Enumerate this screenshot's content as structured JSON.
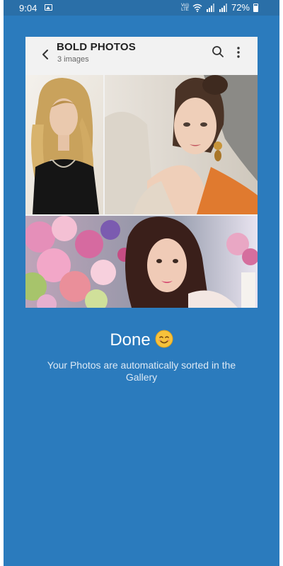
{
  "status_bar": {
    "time": "9:04",
    "volte_line1": "Vo))",
    "volte_line2": "LTE",
    "battery": "72%",
    "icons": [
      "gallery-icon",
      "wifi-icon",
      "signal-icon",
      "signal-icon",
      "battery-icon"
    ]
  },
  "album": {
    "title": "BOLD PHOTOS",
    "count": "3 images",
    "icons": [
      "back-icon",
      "search-icon",
      "more-icon"
    ]
  },
  "photos": [
    {
      "description": "woman with blonde curly hair"
    },
    {
      "description": "woman with updo and earrings"
    },
    {
      "description": "woman with dark hair among flowers"
    }
  ],
  "done": {
    "title": "Done",
    "emoji": "smiling-face-icon",
    "subtitle": "Your Photos are automatically sorted in the Gallery"
  },
  "colors": {
    "background": "#2b7bbd",
    "status_bar": "#2a6fa8",
    "card": "#f2f2f2"
  }
}
